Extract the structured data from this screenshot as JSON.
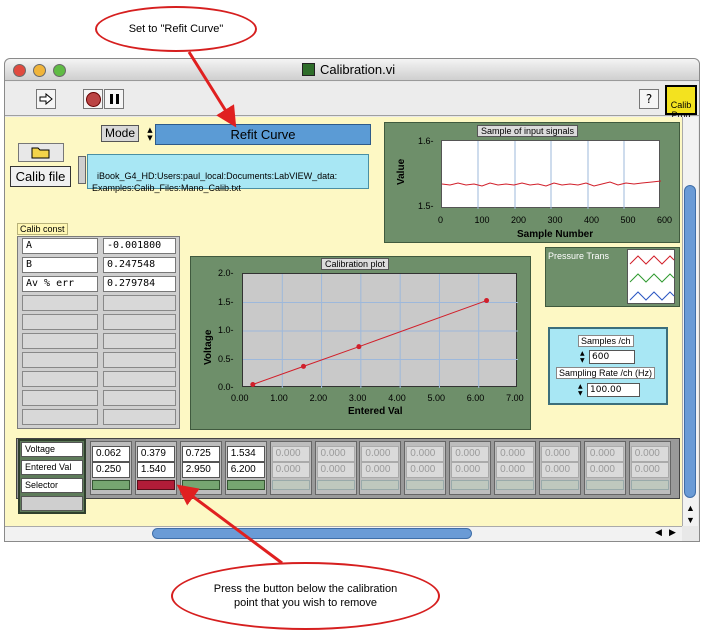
{
  "callouts": {
    "top": "Set to \"Refit Curve\"",
    "bottom": "Press the button below the calibration point that you wish to remove"
  },
  "window": {
    "title": "Calibration.vi"
  },
  "toolbar": {
    "help_label": "?",
    "calib_prog_label": "Calib\nProg",
    "run_icon": "run-arrow-icon",
    "stop_icon": "stop-icon",
    "pause_icon": "pause-icon"
  },
  "mode": {
    "label": "Mode",
    "value": "Refit Curve"
  },
  "calib_file": {
    "button_label": "Calib file",
    "path": "iBook_G4_HD:Users:paul_local:Documents:LabVIEW_data:\nExamples:Calib_Files:Mano_Calib.txt"
  },
  "calib_const": {
    "label": "Calib const",
    "rows": [
      {
        "name": "A",
        "value": "-0.001800"
      },
      {
        "name": "B",
        "value": "0.247548"
      },
      {
        "name": "Av % err",
        "value": "0.279784"
      }
    ]
  },
  "input_chart": {
    "title": "Sample of input signals",
    "ylabel": "Value",
    "xlabel": "Sample Number",
    "yticks": [
      "1.6-",
      "1.5-"
    ],
    "xticks": [
      "0",
      "100",
      "200",
      "300",
      "400",
      "500",
      "600"
    ]
  },
  "pressure_trans": {
    "label": "Pressure Trans"
  },
  "sampling": {
    "samples_label": "Samples /ch",
    "samples_value": "600",
    "rate_label": "Sampling Rate /ch (Hz)",
    "rate_value": "100.00"
  },
  "calib_plot": {
    "title": "Calibration plot",
    "ylabel": "Voltage",
    "xlabel": "Entered Val",
    "yticks": [
      "2.0-",
      "1.5-",
      "1.0-",
      "0.5-",
      "0.0-"
    ],
    "xticks": [
      "0.00",
      "1.00",
      "2.00",
      "3.00",
      "4.00",
      "5.00",
      "6.00",
      "7.00"
    ]
  },
  "chart_data": {
    "type": "line",
    "title": "Calibration plot",
    "xlabel": "Entered Val",
    "ylabel": "Voltage",
    "xlim": [
      0,
      7
    ],
    "ylim": [
      0,
      2
    ],
    "x": [
      0.25,
      1.54,
      2.95,
      6.2
    ],
    "series": [
      {
        "values": [
          0.062,
          0.379,
          0.725,
          1.534
        ]
      }
    ],
    "grid": true
  },
  "array": {
    "row_labels": [
      "Voltage",
      "Entered Val",
      "Selector"
    ],
    "columns": [
      {
        "voltage": "0.062",
        "entered": "0.250",
        "selected": false,
        "active": true
      },
      {
        "voltage": "0.379",
        "entered": "1.540",
        "selected": true,
        "active": true
      },
      {
        "voltage": "0.725",
        "entered": "2.950",
        "selected": false,
        "active": true
      },
      {
        "voltage": "1.534",
        "entered": "6.200",
        "selected": false,
        "active": true
      },
      {
        "voltage": "0.000",
        "entered": "0.000",
        "selected": false,
        "active": false
      },
      {
        "voltage": "0.000",
        "entered": "0.000",
        "selected": false,
        "active": false
      },
      {
        "voltage": "0.000",
        "entered": "0.000",
        "selected": false,
        "active": false
      },
      {
        "voltage": "0.000",
        "entered": "0.000",
        "selected": false,
        "active": false
      },
      {
        "voltage": "0.000",
        "entered": "0.000",
        "selected": false,
        "active": false
      },
      {
        "voltage": "0.000",
        "entered": "0.000",
        "selected": false,
        "active": false
      },
      {
        "voltage": "0.000",
        "entered": "0.000",
        "selected": false,
        "active": false
      },
      {
        "voltage": "0.000",
        "entered": "0.000",
        "selected": false,
        "active": false
      },
      {
        "voltage": "0.000",
        "entered": "0.000",
        "selected": false,
        "active": false
      }
    ]
  },
  "colors": {
    "panel_bg": "#fdf8c4",
    "mode_ring": "#5b9bd5",
    "chart_frame": "#6e8f6a",
    "plot_line": "#d11f2a",
    "callout": "#d61f1f"
  }
}
